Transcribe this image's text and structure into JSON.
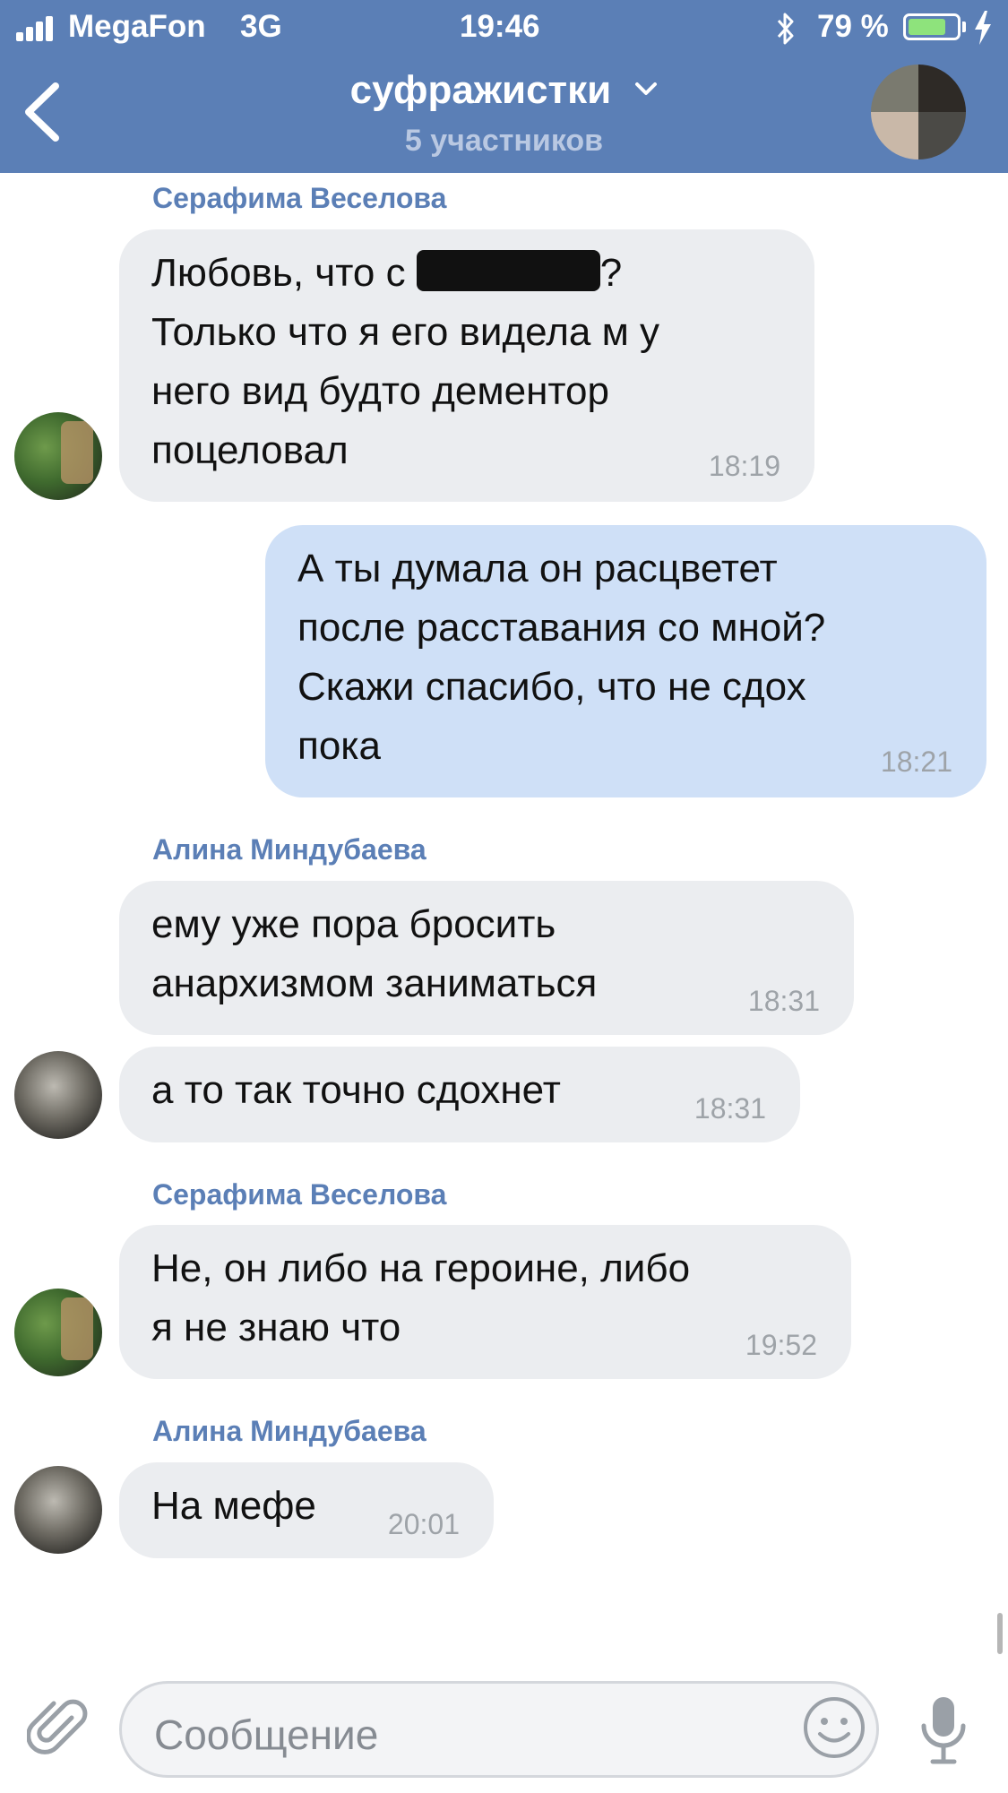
{
  "status_bar": {
    "carrier": "MegaFon",
    "network": "3G",
    "time": "19:46",
    "battery": "79 %",
    "battery_level": 0.79
  },
  "header": {
    "title": "суфражистки",
    "subtitle": "5 участников",
    "title_chevron": "chevron-down-icon",
    "back_icon": "back-chevron-icon"
  },
  "messages": [
    {
      "sender": "Серафима Веселова",
      "direction": "in",
      "text_before_redaction": "Любовь, что с ",
      "text_after_redaction": "?\nТолько что я его видела м у\nнего вид будто дементор\nпоцеловал",
      "time": "18:19"
    },
    {
      "direction": "out",
      "text": "А ты думала он расцветет\nпосле расставания со мной?\nСкажи спасибо, что не сдох\nпока",
      "time": "18:21"
    },
    {
      "sender": "Алина Миндубаева",
      "direction": "in",
      "text": "ему уже пора бросить\nанархизмом заниматься",
      "time": "18:31"
    },
    {
      "direction": "in",
      "text": "а то так точно сдохнет",
      "time": "18:31"
    },
    {
      "sender": "Серафима Веселова",
      "direction": "in",
      "text": "Не, он либо на героине, либо\nя не знаю что",
      "time": "19:52"
    },
    {
      "sender": "Алина Миндубаева",
      "direction": "in",
      "text": "На мефе",
      "time": "20:01"
    }
  ],
  "composer": {
    "placeholder": "Сообщение"
  },
  "colors": {
    "header": "#5b7fb6",
    "incoming_bubble": "#ebedf0",
    "outgoing_bubble": "#cfe0f7",
    "sender_name": "#5b7fb6",
    "timestamp": "#9ea3a8"
  }
}
